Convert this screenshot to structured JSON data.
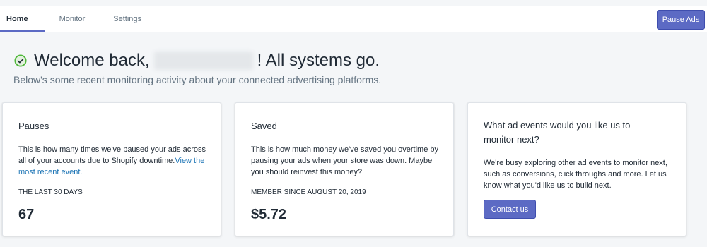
{
  "nav": {
    "tabs": [
      {
        "label": "Home"
      },
      {
        "label": "Monitor"
      },
      {
        "label": "Settings"
      }
    ],
    "pause_button": "Pause Ads"
  },
  "welcome": {
    "prefix": "Welcome back,",
    "suffix": "! All systems go.",
    "subtitle": "Below's some recent monitoring activity about your connected advertising platforms."
  },
  "cards": [
    {
      "title": "Pauses",
      "description": "This is how many times we've paused your ads across all of your accounts due to Shopify downtime.",
      "link": "View the most recent event.",
      "label": "THE LAST 30 DAYS",
      "value": "67"
    },
    {
      "title": "Saved",
      "description": "This is how much money we've saved you overtime by pausing your ads when your store was down. Maybe you should reinvest this money?",
      "label": "MEMBER SINCE AUGUST 20, 2019",
      "value": "$5.72"
    },
    {
      "title": "What ad events would you like us to monitor next?",
      "description": "We're busy exploring other ad events to monitor next, such as conversions, click throughs and more. Let us know what you'd like us to build next.",
      "button": "Contact us"
    }
  ],
  "colors": {
    "accent": "#5c6ac4",
    "success": "#50b83c",
    "link": "#1c74b5",
    "background": "#f4f6f8"
  }
}
